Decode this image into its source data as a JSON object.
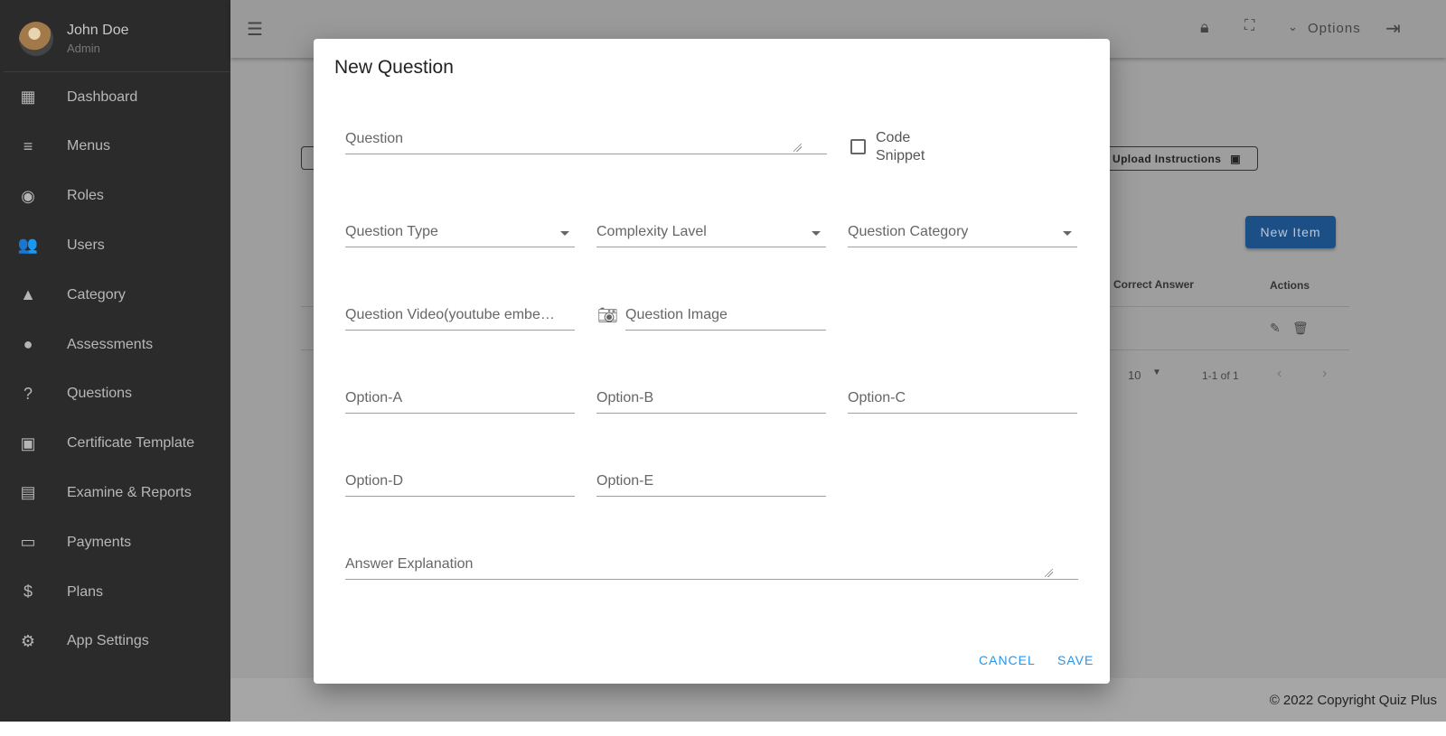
{
  "user": {
    "name": "John Doe",
    "role": "Admin"
  },
  "sidebar": {
    "items": [
      {
        "label": "Dashboard",
        "icon": "dashboard-icon",
        "glyph": "▦"
      },
      {
        "label": "Menus",
        "icon": "menu-open-icon",
        "glyph": "≡"
      },
      {
        "label": "Roles",
        "icon": "roles-icon",
        "glyph": "◉"
      },
      {
        "label": "Users",
        "icon": "users-icon",
        "glyph": "👥"
      },
      {
        "label": "Category",
        "icon": "category-icon",
        "glyph": "▲"
      },
      {
        "label": "Assessments",
        "icon": "lightbulb-icon",
        "glyph": "●"
      },
      {
        "label": "Questions",
        "icon": "help-box-icon",
        "glyph": "?"
      },
      {
        "label": "Certificate Template",
        "icon": "certificate-icon",
        "glyph": "▣"
      },
      {
        "label": "Examine & Reports",
        "icon": "document-icon",
        "glyph": "▤"
      },
      {
        "label": "Payments",
        "icon": "payments-icon",
        "glyph": "▭"
      },
      {
        "label": "Plans",
        "icon": "dollar-icon",
        "glyph": "$"
      },
      {
        "label": "App Settings",
        "icon": "gear-icon",
        "glyph": "⚙"
      }
    ]
  },
  "topbar": {
    "options": "Options"
  },
  "background": {
    "upload_instructions": "Upload Instructions",
    "new_item": "New Item",
    "columns": [
      "Correct Answer",
      "Actions"
    ],
    "rows_per_page": "10",
    "range": "1-1 of 1"
  },
  "footer": "© 2022 Copyright Quiz Plus",
  "dialog": {
    "title": "New Question",
    "question": "Question",
    "code_snippet_1": "Code",
    "code_snippet_2": "Snippet",
    "question_type": "Question Type",
    "complexity": "Complexity Lavel",
    "category": "Question Category",
    "video": "Question Video(youtube embed link)",
    "image": "Question Image",
    "option_a": "Option-A",
    "option_b": "Option-B",
    "option_c": "Option-C",
    "option_d": "Option-D",
    "option_e": "Option-E",
    "explanation": "Answer Explanation",
    "cancel": "CANCEL",
    "save": "SAVE"
  },
  "colors": {
    "accent": "#2196f3",
    "sidebar": "#2b2b2b",
    "new_item": "#1c4f85"
  }
}
